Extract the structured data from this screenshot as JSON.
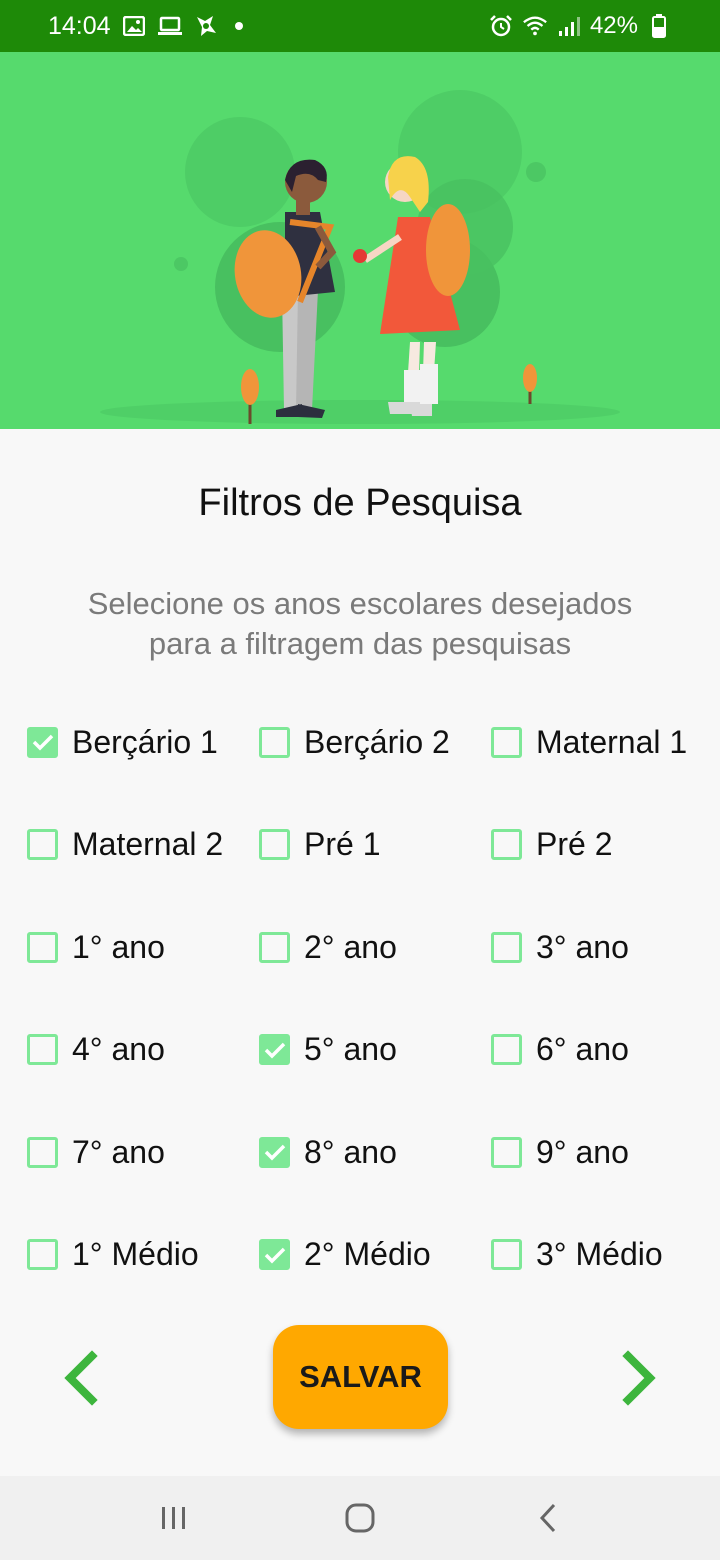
{
  "status_bar": {
    "time": "14:04",
    "icons_left": [
      "image-icon",
      "laptop-icon",
      "app-icon",
      "dot-icon"
    ],
    "icons_right": [
      "alarm-icon",
      "wifi-icon",
      "signal-icon",
      "battery-icon"
    ],
    "battery": "42%",
    "background": "#1e8a08"
  },
  "hero": {
    "background": "#56da6d",
    "illustration": "two-students-with-backpacks"
  },
  "page": {
    "title": "Filtros de Pesquisa",
    "subtitle_line1": "Selecione os anos escolares desejados",
    "subtitle_line2": "para a filtragem das pesquisas"
  },
  "filters": [
    {
      "label": "Berçário 1",
      "checked": true
    },
    {
      "label": "Berçário 2",
      "checked": false
    },
    {
      "label": "Maternal 1",
      "checked": false
    },
    {
      "label": "Maternal 2",
      "checked": false
    },
    {
      "label": "Pré 1",
      "checked": false
    },
    {
      "label": "Pré 2",
      "checked": false
    },
    {
      "label": "1° ano",
      "checked": false
    },
    {
      "label": "2° ano",
      "checked": false
    },
    {
      "label": "3° ano",
      "checked": false
    },
    {
      "label": "4° ano",
      "checked": false
    },
    {
      "label": "5° ano",
      "checked": true
    },
    {
      "label": "6° ano",
      "checked": false
    },
    {
      "label": "7° ano",
      "checked": false
    },
    {
      "label": "8° ano",
      "checked": true
    },
    {
      "label": "9° ano",
      "checked": false
    },
    {
      "label": "1° Médio",
      "checked": false
    },
    {
      "label": "2° Médio",
      "checked": true
    },
    {
      "label": "3° Médio",
      "checked": false
    }
  ],
  "actions": {
    "save_label": "SALVAR",
    "save_color": "#ffa800",
    "prev_icon": "chevron-left-icon",
    "next_icon": "chevron-right-icon",
    "arrow_color": "#3db53d"
  },
  "colors": {
    "checkbox": "#7ee897"
  },
  "system_nav": [
    "recents-icon",
    "home-icon",
    "back-icon"
  ]
}
